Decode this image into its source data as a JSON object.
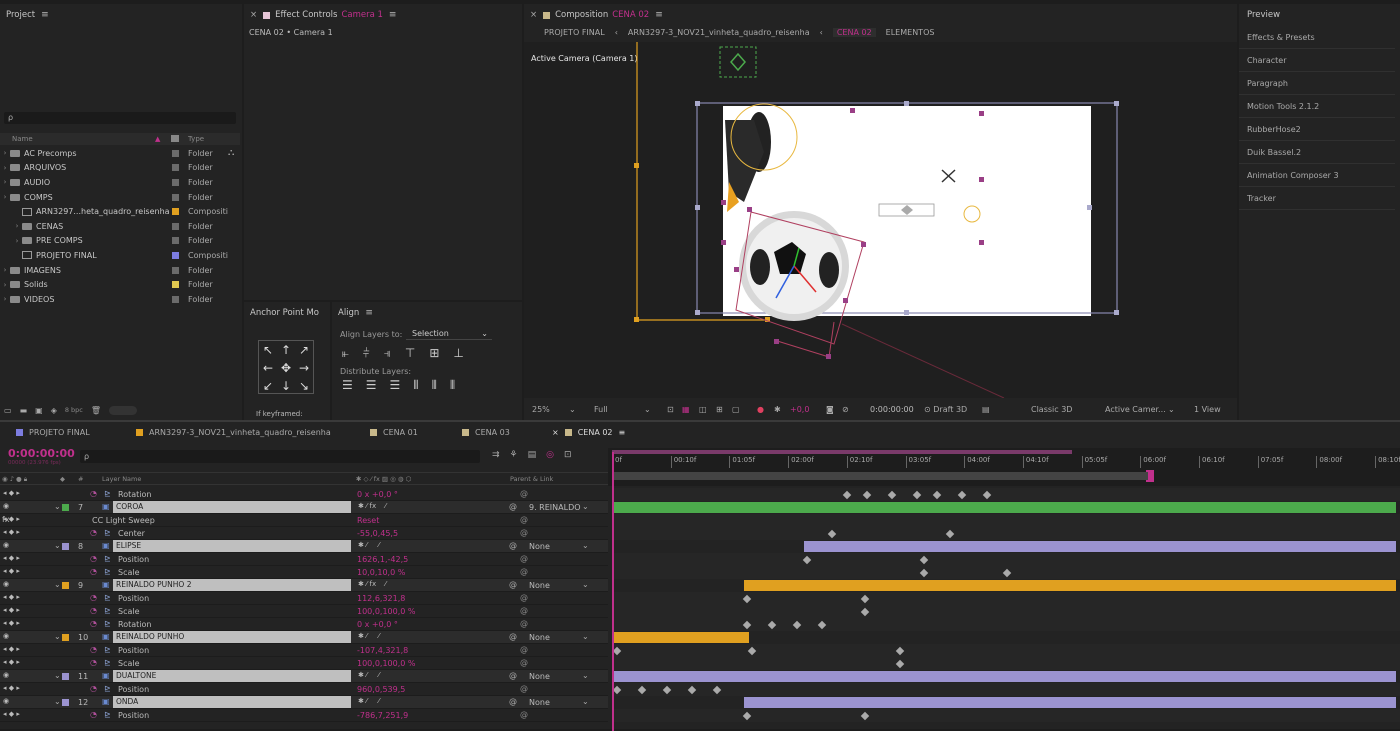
{
  "project": {
    "title": "Project",
    "search_placeholder": "ρ",
    "col_name": "Name",
    "col_type": "Type",
    "bpc": "8 bpc",
    "items": [
      {
        "name": "AC Precomps",
        "type": "Folder",
        "kind": "folder",
        "indent": 0,
        "color": "#6b6b6b"
      },
      {
        "name": "ARQUIVOS",
        "type": "Folder",
        "kind": "folder",
        "indent": 0,
        "color": "#6b6b6b"
      },
      {
        "name": "AUDIO",
        "type": "Folder",
        "kind": "folder",
        "indent": 0,
        "color": "#6b6b6b"
      },
      {
        "name": "COMPS",
        "type": "Folder",
        "kind": "folder",
        "indent": 0,
        "color": "#6b6b6b"
      },
      {
        "name": "ARN3297...heta_quadro_reisenha",
        "type": "Compositi",
        "kind": "comp",
        "indent": 1,
        "color": "#e0a020"
      },
      {
        "name": "CENAS",
        "type": "Folder",
        "kind": "folder",
        "indent": 1,
        "color": "#6b6b6b"
      },
      {
        "name": "PRE COMPS",
        "type": "Folder",
        "kind": "folder",
        "indent": 1,
        "color": "#6b6b6b"
      },
      {
        "name": "PROJETO FINAL",
        "type": "Compositi",
        "kind": "comp",
        "indent": 1,
        "color": "#7d7de0"
      },
      {
        "name": "IMAGENS",
        "type": "Folder",
        "kind": "folder",
        "indent": 0,
        "color": "#6b6b6b"
      },
      {
        "name": "Solids",
        "type": "Folder",
        "kind": "folder",
        "indent": 0,
        "color": "#e0c850"
      },
      {
        "name": "VIDEOS",
        "type": "Folder",
        "kind": "folder",
        "indent": 0,
        "color": "#6b6b6b"
      }
    ]
  },
  "effect_controls": {
    "title": "Effect Controls",
    "layer": "Camera 1",
    "subtitle": "CENA 02 • Camera 1"
  },
  "anchor": {
    "title": "Anchor Point Mo",
    "keyframes": "If keyframed:"
  },
  "align": {
    "title": "Align",
    "align_to_label": "Align Layers to:",
    "align_to_value": "Selection",
    "distribute_label": "Distribute Layers:"
  },
  "composition": {
    "title": "Composition",
    "name": "CENA 02",
    "breadcrumbs": [
      "PROJETO FINAL",
      "ARN3297-3_NOV21_vinheta_quadro_reisenha",
      "CENA 02",
      "ELEMENTOS"
    ],
    "active_camera": "Active Camera (Camera 1)",
    "footer": {
      "zoom": "25%",
      "resolution": "Full",
      "exposure": "+0,0",
      "timecode": "0:00:00:00",
      "draft": "Draft 3D",
      "renderer": "Classic 3D",
      "camera": "Active Camer...",
      "views": "1 View"
    }
  },
  "right_panel": {
    "title": "Preview",
    "items": [
      "Effects & Presets",
      "Character",
      "Paragraph",
      "Motion Tools 2.1.2",
      "RubberHose2",
      "Duik Bassel.2",
      "Animation Composer 3",
      "Tracker"
    ]
  },
  "timeline": {
    "tabs": [
      {
        "label": "PROJETO FINAL",
        "color": "#7d7de0"
      },
      {
        "label": "ARN3297-3_NOV21_vinheta_quadro_reisenha",
        "color": "#e0a020"
      },
      {
        "label": "CENA 01",
        "color": "#c8b88a"
      },
      {
        "label": "CENA 03",
        "color": "#c8b88a"
      },
      {
        "label": "CENA 02",
        "color": "#c8b88a"
      }
    ],
    "timecode": "0:00:00:00",
    "fps": "00000 (23.976 fps)",
    "col_layer": "Layer Name",
    "col_parent": "Parent & Link",
    "ruler": [
      "0f",
      "00:10f",
      "01:05f",
      "02:00f",
      "02:10f",
      "03:05f",
      "04:00f",
      "04:10f",
      "05:05f",
      "06:00f",
      "06:10f",
      "07:05f",
      "08:00f",
      "08:10f"
    ],
    "rows": [
      {
        "type": "prop",
        "name": "Rotation",
        "value": "0 x +0,0 °",
        "bar": null
      },
      {
        "type": "layer",
        "num": "7",
        "name": "COROA",
        "color": "#4caa4c",
        "parent": "9. REINALDO",
        "barColor": "#4caa4c",
        "barStart": 0
      },
      {
        "type": "effect",
        "name": "CC Light Sweep",
        "value": "Reset",
        "bar": null
      },
      {
        "type": "prop",
        "name": "Center",
        "value": "-55,0,45,5",
        "bar": null
      },
      {
        "type": "layer",
        "num": "8",
        "name": "ELIPSE",
        "color": "#9b93d0",
        "parent": "None",
        "barColor": "#9b93d0",
        "barStart": 190
      },
      {
        "type": "prop",
        "name": "Position",
        "value": "1626,1,-42,5",
        "bar": null
      },
      {
        "type": "prop",
        "name": "Scale",
        "value": "10,0,10,0 %",
        "bar": null
      },
      {
        "type": "layer",
        "num": "9",
        "name": "REINALDO PUNHO 2",
        "color": "#e0a020",
        "parent": "None",
        "barColor": "#e0a020",
        "barStart": 130
      },
      {
        "type": "prop",
        "name": "Position",
        "value": "112,6,321,8",
        "bar": null
      },
      {
        "type": "prop",
        "name": "Scale",
        "value": "100,0,100,0 %",
        "bar": null
      },
      {
        "type": "prop",
        "name": "Rotation",
        "value": "0 x +0,0 °",
        "bar": null
      },
      {
        "type": "layer",
        "num": "10",
        "name": "REINALDO PUNHO",
        "color": "#e0a020",
        "parent": "None",
        "barColor": "#e0a020",
        "barStart": 0,
        "barEnd": 135
      },
      {
        "type": "prop",
        "name": "Position",
        "value": "-107,4,321,8",
        "bar": null
      },
      {
        "type": "prop",
        "name": "Scale",
        "value": "100,0,100,0 %",
        "bar": null
      },
      {
        "type": "layer",
        "num": "11",
        "name": "DUALTONE",
        "color": "#9b93d0",
        "parent": "None",
        "barColor": "#9b93d0",
        "barStart": 0
      },
      {
        "type": "prop",
        "name": "Position",
        "value": "960,0,539,5",
        "bar": null
      },
      {
        "type": "layer",
        "num": "12",
        "name": "ONDA",
        "color": "#9b93d0",
        "parent": "None",
        "barColor": "#9b93d0",
        "barStart": 130
      },
      {
        "type": "prop",
        "name": "Position",
        "value": "-786,7,251,9",
        "bar": null
      }
    ]
  }
}
